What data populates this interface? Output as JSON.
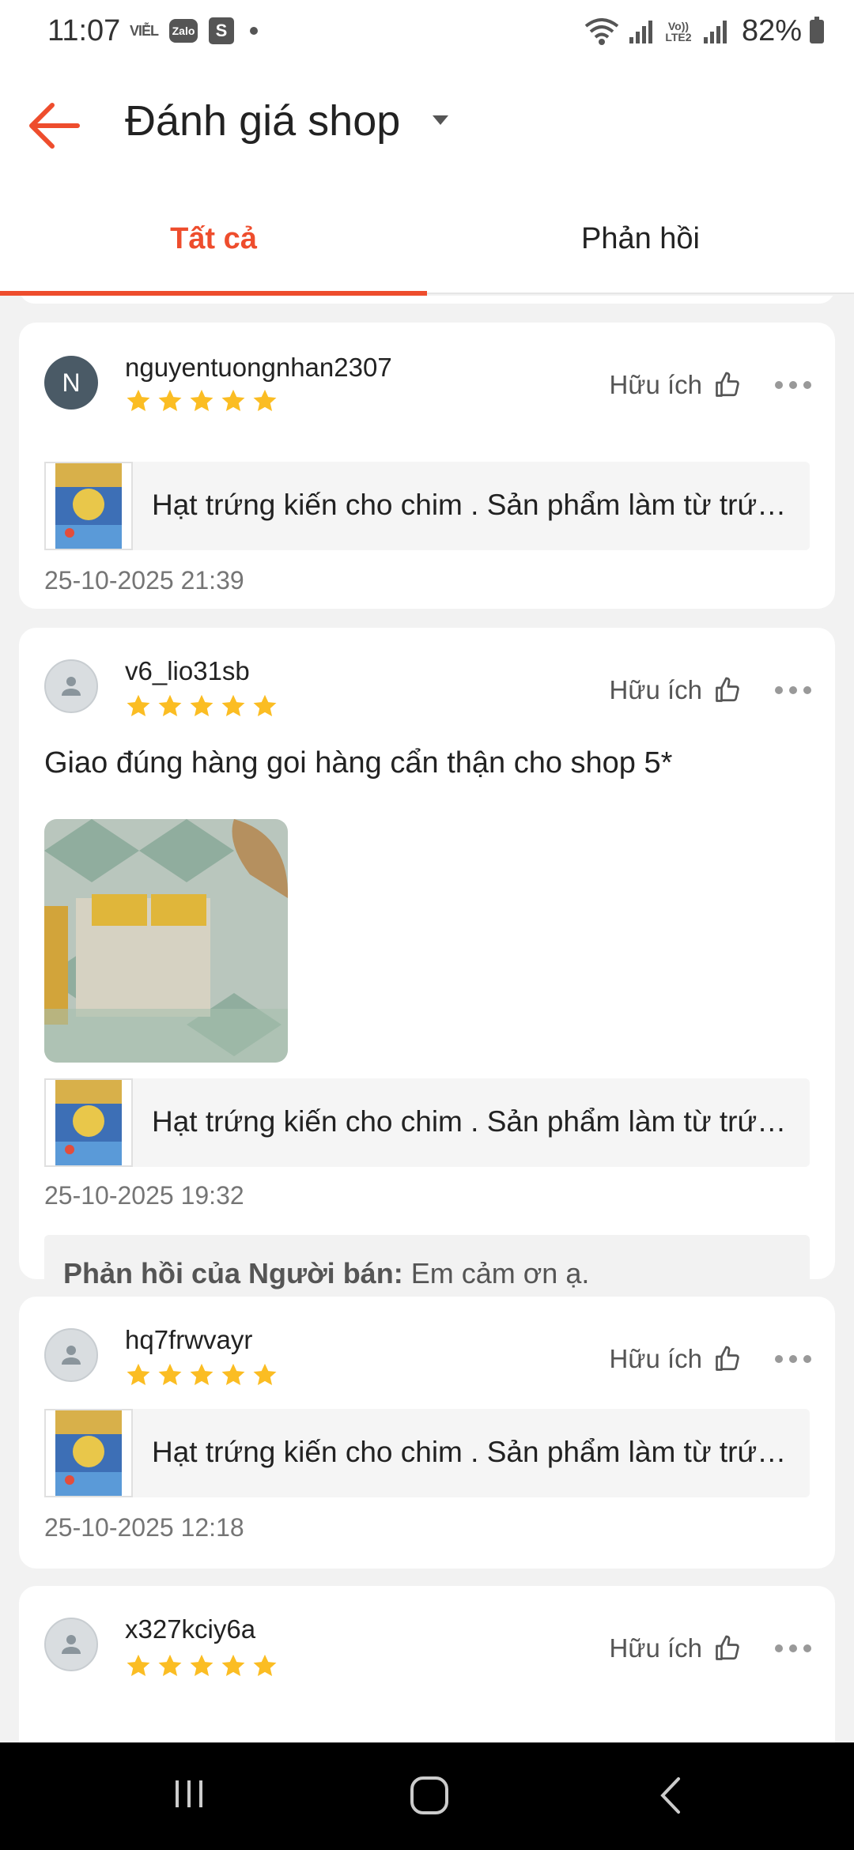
{
  "status_bar": {
    "time": "11:07",
    "vil": "VIỄL",
    "zalo": "Zalo",
    "shop": "S",
    "lte": "Vo)) LTE2",
    "battery": "82%"
  },
  "header": {
    "title": "Đánh giá shop",
    "back_icon": "arrow-left-icon",
    "dropdown_icon": "caret-down-icon",
    "accent_color": "#ee4d2d"
  },
  "tabs": [
    {
      "label": "Tất cả",
      "active": true
    },
    {
      "label": "Phản hồi",
      "active": false
    }
  ],
  "reviews": [
    {
      "username": "nguyentuongnhan2307",
      "avatar_letter": "N",
      "rating": 5,
      "helpful_label": "Hữu ích",
      "product": "Hạt trứng kiến cho chim . Sản phẩm làm từ trứng kiến",
      "date": "25-10-2025 21:39"
    },
    {
      "username": "v6_lio31sb",
      "rating": 5,
      "helpful_label": "Hữu ích",
      "comment": "Giao đúng hàng goi hàng cẩn thận cho shop 5*",
      "product": "Hạt trứng kiến cho chim . Sản phẩm làm từ trứng kiến",
      "date": "25-10-2025 19:32",
      "reply_label": "Phản hồi của Người bán:",
      "reply_text": " Em cảm ơn ạ."
    },
    {
      "username": "hq7frwvayr",
      "rating": 5,
      "helpful_label": "Hữu ích",
      "product": "Hạt trứng kiến cho chim . Sản phẩm làm từ trứng kiến",
      "date": "25-10-2025 12:18"
    },
    {
      "username": "x327kciy6a",
      "rating": 5,
      "helpful_label": "Hữu ích"
    }
  ],
  "nav": {
    "recents_icon": "recent-apps-icon",
    "home_icon": "home-icon",
    "back_icon": "back-chevron-icon"
  }
}
